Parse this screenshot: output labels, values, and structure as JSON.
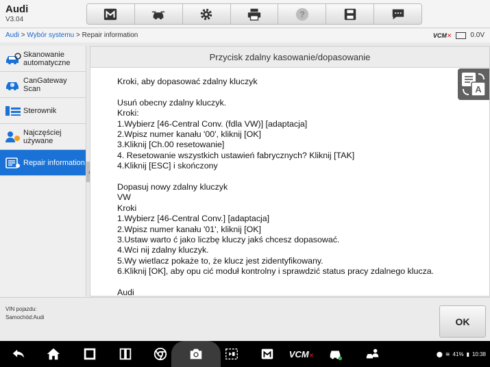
{
  "header": {
    "brand": "Audi",
    "version": "V3.04",
    "toolbar": [
      {
        "name": "home-icon"
      },
      {
        "name": "vehicle-swap-icon"
      },
      {
        "name": "settings-gear-icon"
      },
      {
        "name": "printer-icon"
      },
      {
        "name": "help-icon"
      },
      {
        "name": "save-icon"
      },
      {
        "name": "message-icon"
      }
    ]
  },
  "breadcrumb": {
    "part1": "Audi",
    "sep1": " > ",
    "part2": "Wybór systemu",
    "sep2": " > ",
    "current": "Repair information",
    "vcm": "VCM",
    "voltage": "0.0V"
  },
  "sidebar": {
    "items": [
      {
        "label": "Skanowanie automatyczne",
        "icon": "auto-scan-car-icon"
      },
      {
        "label": "CanGateway Scan",
        "icon": "gateway-car-icon"
      },
      {
        "label": "Sterownik",
        "icon": "control-unit-icon"
      },
      {
        "label": "Najczęściej używane",
        "icon": "favorites-user-icon"
      },
      {
        "label": "Repair information",
        "icon": "repair-info-icon",
        "active": true
      }
    ]
  },
  "main": {
    "title": "Przycisk zdalny kasowanie/dopasowanie",
    "lines": [
      "Kroki, aby dopasować zdalny kluczyk",
      "",
      "Usuń obecny zdalny kluczyk.",
      "Kroki:",
      "1.Wybierz [46-Central Conv. (fdla VW)] [adaptacja]",
      "2.Wpisz numer kanału '00', kliknij [OK]",
      "3.Kliknij [Ch.00 resetowanie]",
      "4. Resetowanie wszystkich ustawień fabrycznych? Kliknij [TAK]",
      "4.Kliknij [ESC] i skończony",
      "",
      "Dopasuj nowy zdalny kluczyk",
      "VW",
      "Kroki",
      "1.Wybierz [46-Central Conv.] [adaptacja]",
      "2.Wpisz numer kanału '01', kliknij [OK]",
      "3.Ustaw warto ć jako liczbę kluczy jakś chcesz dopasować.",
      "4.Wci nij zdalny kluczyk.",
      "5.Wy wietlacz pokaże to, że klucz jest zidentyfikowany.",
      "6.Kliknij [OK], aby opu cić moduł kontrolny i sprawdzić status pracy zdalnego klucza.",
      "",
      "Audi"
    ]
  },
  "footer": {
    "vin_label": "VIN pojazdu:",
    "car_label": "Samochód:Audi",
    "ok": "OK"
  },
  "navbar": {
    "vcm": "VCM",
    "battery": "41%",
    "time": "10:38"
  },
  "colors": {
    "accent": "#1a72d6",
    "link": "#1a66c9",
    "error": "#e02020"
  }
}
